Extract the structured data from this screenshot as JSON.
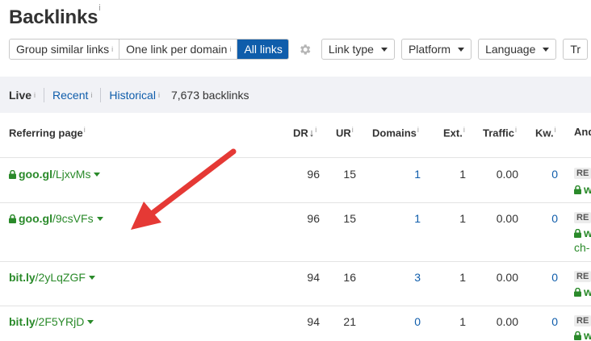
{
  "title": "Backlinks",
  "info_mark": "i",
  "toolbar": {
    "segments": [
      {
        "label": "Group similar links",
        "info": true,
        "active": false
      },
      {
        "label": "One link per domain",
        "info": true,
        "active": false
      },
      {
        "label": "All links",
        "info": false,
        "active": true
      }
    ],
    "dropdowns": [
      "Link type",
      "Platform",
      "Language",
      "Tr"
    ]
  },
  "filters": {
    "live": "Live",
    "recent": "Recent",
    "historical": "Historical",
    "count": "7,673 backlinks"
  },
  "columns": {
    "referring_page": "Referring page",
    "dr": "DR",
    "ur": "UR",
    "domains": "Domains",
    "ext": "Ext.",
    "traffic": "Traffic",
    "kw": "Kw.",
    "anchor": "And"
  },
  "rows": [
    {
      "secure": true,
      "domain": "goo.gl",
      "path": "/LjxvMs",
      "dr": "96",
      "ur": "15",
      "domains": "1",
      "ext": "1",
      "traffic": "0.00",
      "kw": "0",
      "badge": "RE",
      "anchor_line2": "w",
      "anchor_line3": ""
    },
    {
      "secure": true,
      "domain": "goo.gl",
      "path": "/9csVFs",
      "dr": "96",
      "ur": "15",
      "domains": "1",
      "ext": "1",
      "traffic": "0.00",
      "kw": "0",
      "badge": "RE",
      "anchor_line2": "w",
      "anchor_line3": "ch-"
    },
    {
      "secure": false,
      "domain": "bit.ly",
      "path": "/2yLqZGF",
      "dr": "94",
      "ur": "16",
      "domains": "3",
      "ext": "1",
      "traffic": "0.00",
      "kw": "0",
      "badge": "RE",
      "anchor_line2": "w",
      "anchor_line3": ""
    },
    {
      "secure": false,
      "domain": "bit.ly",
      "path": "/2F5YRjD",
      "dr": "94",
      "ur": "21",
      "domains": "0",
      "ext": "1",
      "traffic": "0.00",
      "kw": "0",
      "badge": "RE",
      "anchor_line2": "w",
      "anchor_line3": ""
    }
  ],
  "colors": {
    "accent": "#0f5dab",
    "link_green": "#2a8a2a",
    "annotation_arrow": "#e53935",
    "band": "#f1f2f6"
  }
}
